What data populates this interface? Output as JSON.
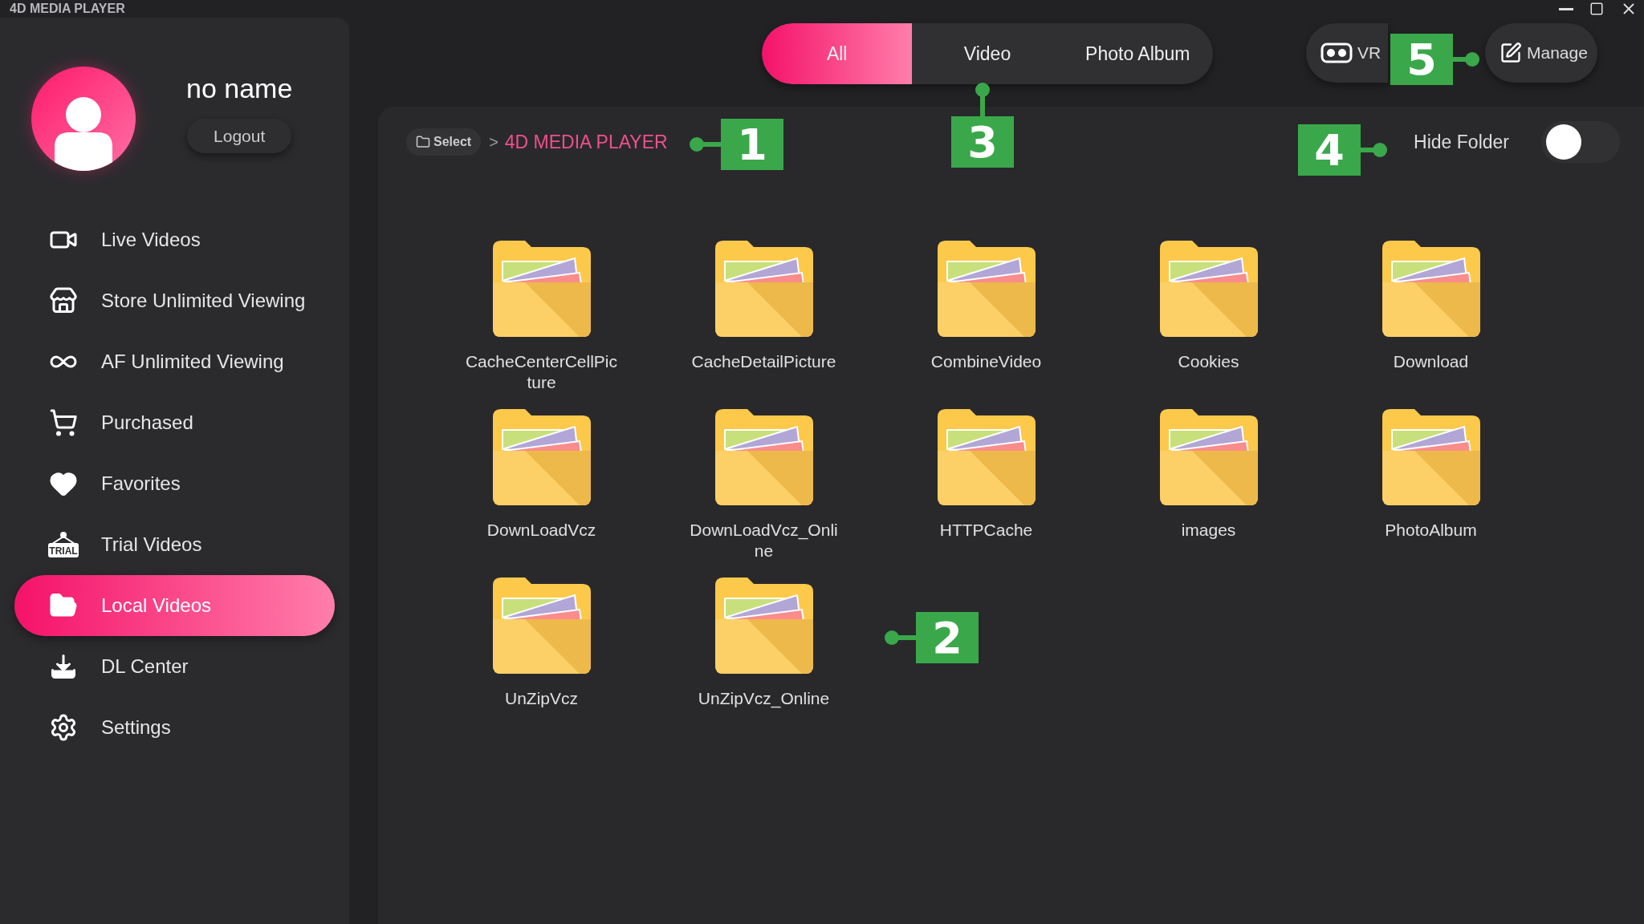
{
  "window": {
    "title": "4D MEDIA PLAYER"
  },
  "user": {
    "name": "no name",
    "logout": "Logout"
  },
  "sidebar": {
    "items": [
      {
        "label": "Live Videos",
        "selected": false
      },
      {
        "label": "Store Unlimited Viewing",
        "selected": false
      },
      {
        "label": "AF Unlimited Viewing",
        "selected": false
      },
      {
        "label": "Purchased",
        "selected": false
      },
      {
        "label": "Favorites",
        "selected": false
      },
      {
        "label": "Trial Videos",
        "selected": false,
        "badge": "TRIAL"
      },
      {
        "label": "Local Videos",
        "selected": true
      },
      {
        "label": "DL Center",
        "selected": false
      },
      {
        "label": "Settings",
        "selected": false
      }
    ]
  },
  "tabs": [
    {
      "label": "All",
      "selected": true
    },
    {
      "label": "Video",
      "selected": false
    },
    {
      "label": "Photo Album",
      "selected": false
    }
  ],
  "actions": [
    {
      "label": "VR"
    },
    {
      "label": "Manage"
    }
  ],
  "breadcrumb": {
    "select": "Select",
    "separator": ">",
    "path": "4D MEDIA PLAYER"
  },
  "hide_folder": {
    "label": "Hide Folder",
    "on": false
  },
  "folders": [
    "CacheCenterCellPicture",
    "CacheDetailPicture",
    "CombineVideo",
    "Cookies",
    "Download",
    "DownLoadVcz",
    "DownLoadVcz_Online",
    "HTTPCache",
    "images",
    "PhotoAlbum",
    "UnZipVcz",
    "UnZipVcz_Online"
  ],
  "callouts": [
    {
      "label": "1"
    },
    {
      "label": "2"
    },
    {
      "label": "3"
    },
    {
      "label": "4"
    },
    {
      "label": "5"
    }
  ]
}
